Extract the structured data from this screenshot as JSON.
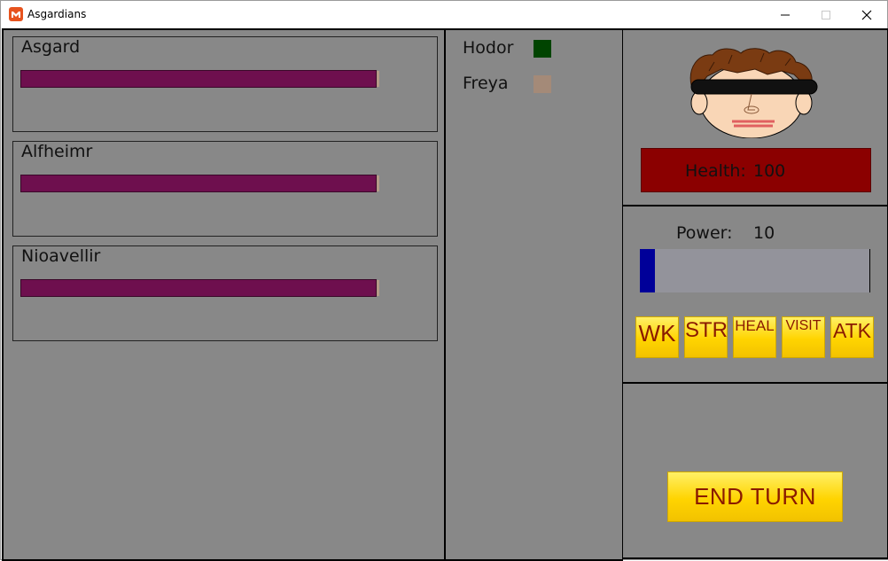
{
  "window": {
    "title": "Asgardians"
  },
  "realms": [
    {
      "name": "Asgard",
      "value": 0.99
    },
    {
      "name": "Alfheimr",
      "value": 0.99
    },
    {
      "name": "Nioavellir",
      "value": 0.99
    }
  ],
  "members": [
    {
      "name": "Hodor",
      "color": "#004400"
    },
    {
      "name": "Freya",
      "color": "#a48a78"
    }
  ],
  "player": {
    "health_label": "Health:",
    "health_value": "100",
    "power_label": "Power:",
    "power_value": "10",
    "power_fraction": 0.065
  },
  "actions": [
    "WK",
    "STR",
    "HEAL",
    "VISIT",
    "ATK"
  ],
  "end_turn_label": "END TURN",
  "colors": {
    "background": "#888888",
    "realm_bar": "#6e0f4e",
    "health_box": "#8b0000",
    "power_fill": "#000099",
    "button_yellow": "#ffd400",
    "button_text": "#8a1a00"
  }
}
